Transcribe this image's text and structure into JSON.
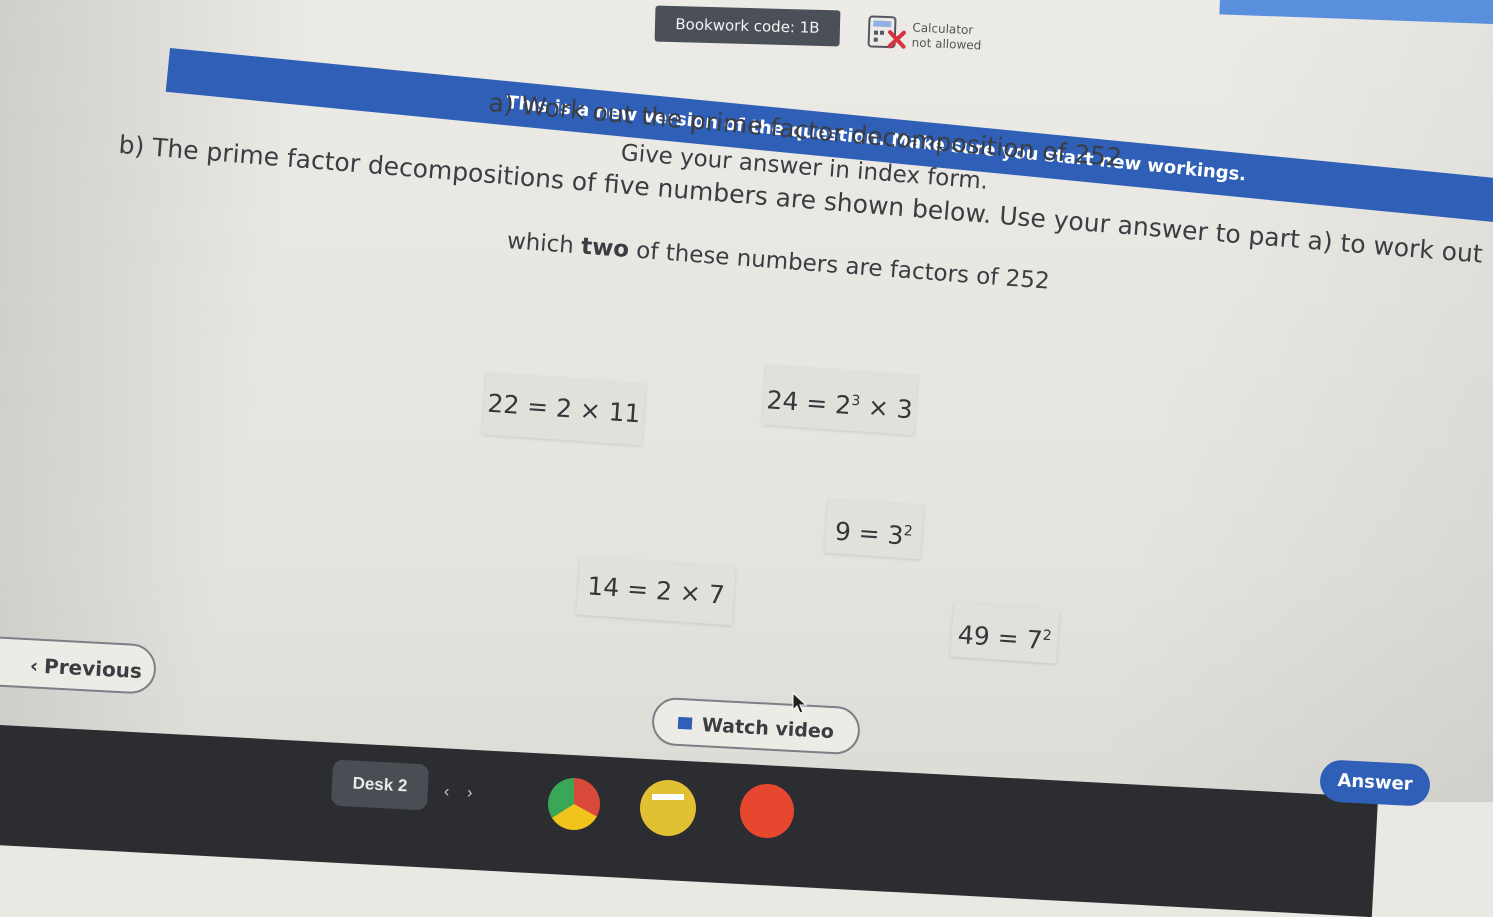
{
  "header": {
    "bookwork_label": "Bookwork code: 1B",
    "calculator_line1": "Calculator",
    "calculator_line2": "not allowed",
    "banner_text": "This is a new version of the question. Make sure you start new workings."
  },
  "question": {
    "part_a_line1": "a) Work out the prime factor decomposition of 252",
    "part_a_line2": "Give your answer in index form.",
    "part_b_line1": "b) The prime factor decompositions of five numbers are shown below. Use your answer to part a) to work out",
    "part_b_line2_pre": "which ",
    "part_b_line2_bold": "two",
    "part_b_line2_post": " of these numbers are factors of 252"
  },
  "cards": [
    {
      "base": "22",
      "eq": "=",
      "rhs_a": "2",
      "op": "×",
      "rhs_b": "11"
    },
    {
      "base": "24",
      "eq": "=",
      "rhs_a": "2",
      "rhs_a_exp": "3",
      "op": "×",
      "rhs_b": "3"
    },
    {
      "base": "9",
      "eq": "=",
      "rhs_a": "3",
      "rhs_a_exp": "2"
    },
    {
      "base": "14",
      "eq": "=",
      "rhs_a": "2",
      "op": "×",
      "rhs_b": "7"
    },
    {
      "base": "49",
      "eq": "=",
      "rhs_a": "7",
      "rhs_a_exp": "2"
    }
  ],
  "buttons": {
    "previous_label": "Previous",
    "watch_video_label": "Watch video",
    "answer_label": "Answer"
  },
  "taskbar": {
    "desk_label": "Desk 2",
    "nav_back": "‹",
    "nav_forward": "›"
  },
  "icons": {
    "calculator": "calculator-not-allowed-icon",
    "video": "video-icon",
    "chevron": "chevron-left-icon",
    "cursor": "mouse-pointer-icon"
  },
  "colors": {
    "banner_blue": "#2f5fb6",
    "bookwork_grey": "#4b5058",
    "calculator_cross": "#d8323a",
    "answer_blue": "#2f5fb6"
  }
}
